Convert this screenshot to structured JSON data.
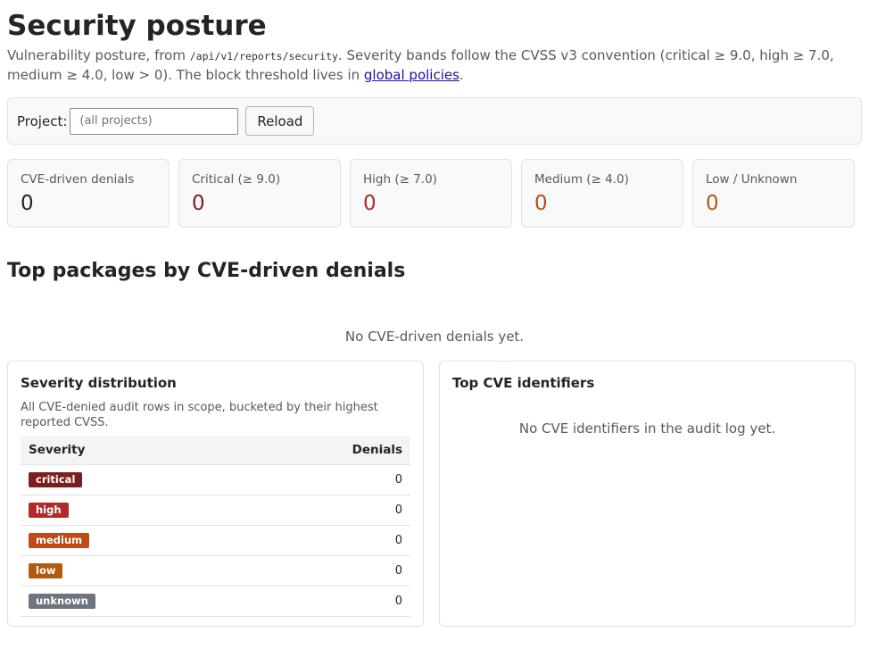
{
  "page": {
    "title": "Security posture",
    "intro": {
      "before_code": "Vulnerability posture, from ",
      "code": "/api/v1/reports/security",
      "after_code": ". Severity bands follow the CVSS v3 convention (critical ≥ 9.0, high ≥ 7.0, medium ≥ 4.0, low > 0). The block threshold lives in ",
      "link": "global policies",
      "end": "."
    }
  },
  "filter": {
    "label": "Project:",
    "placeholder": "(all projects)",
    "value": "",
    "reload_label": "Reload"
  },
  "stats": [
    {
      "label": "CVE-driven denials",
      "value": "0",
      "color": "#212529"
    },
    {
      "label": "Critical (≥ 9.0)",
      "value": "0",
      "color": "#7b1e1e"
    },
    {
      "label": "High (≥ 7.0)",
      "value": "0",
      "color": "#b02a2a"
    },
    {
      "label": "Medium (≥ 4.0)",
      "value": "0",
      "color": "#c04a17"
    },
    {
      "label": "Low / Unknown",
      "value": "0",
      "color": "#b05a12"
    }
  ],
  "top_packages": {
    "heading": "Top packages by CVE-driven denials",
    "empty": "No CVE-driven denials yet."
  },
  "severity_panel": {
    "title": "Severity distribution",
    "description": "All CVE-denied audit rows in scope, bucketed by their highest reported CVSS.",
    "columns": [
      "Severity",
      "Denials"
    ],
    "rows": [
      {
        "severity": "critical",
        "denials": "0",
        "color": "#7b1e1e"
      },
      {
        "severity": "high",
        "denials": "0",
        "color": "#b02a2a"
      },
      {
        "severity": "medium",
        "denials": "0",
        "color": "#c04a17"
      },
      {
        "severity": "low",
        "denials": "0",
        "color": "#b05a12"
      },
      {
        "severity": "unknown",
        "denials": "0",
        "color": "#6c757d"
      }
    ]
  },
  "cve_panel": {
    "title": "Top CVE identifiers",
    "empty": "No CVE identifiers in the audit log yet."
  }
}
